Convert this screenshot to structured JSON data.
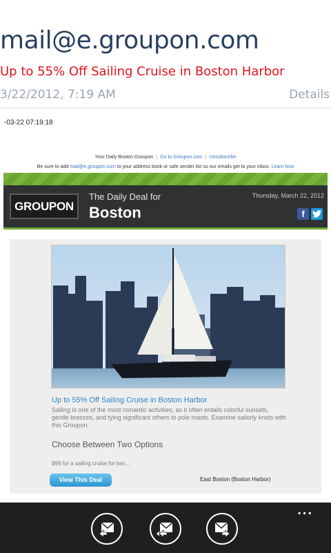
{
  "email": {
    "sender": "mail@e.groupon.com",
    "subject": "Up to 55% Off Sailing Cruise in Boston Harbor",
    "date": "3/22/2012, 7:19 AM",
    "details_label": "Details",
    "timestamp": "-03-22 07:19:18"
  },
  "body": {
    "top_links": {
      "prefix": "Your Daily Boston Groupon",
      "link1": "Go to Groupon.com",
      "link2": "Unsubscribe"
    },
    "address_line": {
      "pre": "Be sure to add ",
      "email": "mail@e.groupon.com",
      "post": " to your address book or safe sender list so our emails get to your inbox.",
      "learn": "Learn how"
    },
    "header": {
      "logo": "GROUPON",
      "daily_deal": "The Daily Deal for",
      "city": "Boston",
      "date": "Thursday, March 22, 2012",
      "facebook": "f",
      "twitter": "t"
    },
    "deal": {
      "title": "Up to 55% Off Sailing Cruise in Boston Harbor",
      "description": "Sailing is one of the most romantic activities, as it often entails colorful sunsets, gentle breezes, and tying significant others to pole masts. Examine sailorly knots with this Groupon.",
      "choose_heading": "Choose Between Two Options",
      "option": "$99 for a sailing cruise for two...",
      "view_button": "View This Deal",
      "location": "East Boston (Boston Harbor)"
    }
  },
  "app_bar": {
    "buttons": [
      "reply-icon",
      "reply-all-icon",
      "forward-icon"
    ],
    "more_label": "..."
  },
  "colors": {
    "sender": "#2a3f5f",
    "subject": "#e3141c",
    "link": "#2d86c8",
    "groupon_green": "#6cab30",
    "app_bar": "#1f1f1f"
  }
}
